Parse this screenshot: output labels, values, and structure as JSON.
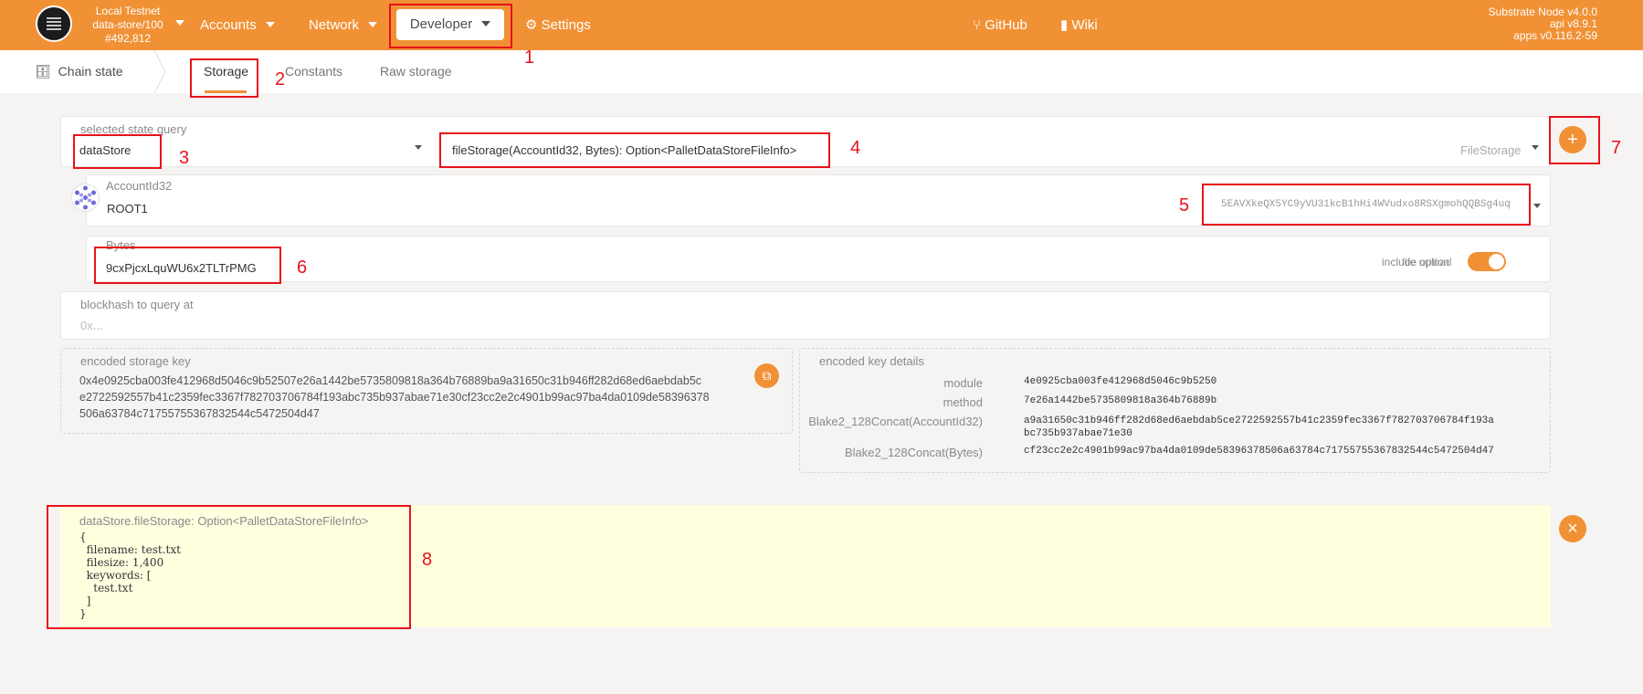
{
  "topbar": {
    "chain_name": "Local Testnet",
    "chain_runtime": "data-store/100",
    "block": "#492,812",
    "nav": {
      "accounts": "Accounts",
      "network": "Network",
      "developer": "Developer",
      "settings": "Settings",
      "github": "GitHub",
      "wiki": "Wiki"
    },
    "version": {
      "node": "Substrate Node v4.0.0",
      "api": "api v8.9.1",
      "apps": "apps v0.116.2-59"
    }
  },
  "subnav": {
    "section": "Chain state",
    "tabs": [
      "Storage",
      "Constants",
      "Raw storage"
    ]
  },
  "query": {
    "label": "selected state query",
    "module": "dataStore",
    "method": "fileStorage(AccountId32, Bytes): Option<PalletDataStoreFileInfo>",
    "doc": "FileStorage"
  },
  "account": {
    "label": "AccountId32",
    "name": "ROOT1",
    "address": "5EAVXkeQX5YC9yVU31kcB1hHi4WVudxo8RSXgmohQQBSg4uq"
  },
  "bytes": {
    "label": "Bytes",
    "value": "9cxPjcxLquWU6x2TLTrPMG",
    "toggle_label_1": "include option",
    "toggle_label_2": "file upload"
  },
  "blockhash": {
    "label": "blockhash to query at",
    "placeholder": "0x..."
  },
  "encoded_key": {
    "label": "encoded storage key",
    "lines": [
      "0x4e0925cba003fe412968d5046c9b52507e26a1442be5735809818a364b76889ba9a31650c31b946ff282d68ed6aebdab5c",
      "e2722592557b41c2359fec3367f782703706784f193abc735b937abae71e30cf23cc2e2c4901b99ac97ba4da0109de58396378",
      "506a63784c71755755367832544c5472504d47"
    ]
  },
  "key_details": {
    "label": "encoded key details",
    "rows": [
      {
        "k": "module",
        "v": "4e0925cba003fe412968d5046c9b5250"
      },
      {
        "k": "method",
        "v": "7e26a1442be5735809818a364b76889b"
      },
      {
        "k": "Blake2_128Concat(AccountId32)",
        "v": "a9a31650c31b946ff282d68ed6aebdab5ce2722592557b41c2359fec3367f782703706784f193a",
        "v2": "bc735b937abae71e30"
      },
      {
        "k": "Blake2_128Concat(Bytes)",
        "v": "cf23cc2e2c4901b99ac97ba4da0109de58396378506a63784c71755755367832544c5472504d47"
      }
    ]
  },
  "result": {
    "title": "dataStore.fileStorage: Option<PalletDataStoreFileInfo>",
    "body": "{\n  filename: test.txt\n  filesize: 1,400\n  keywords: [\n    test.txt\n  ]\n}"
  },
  "annotations": [
    "1",
    "2",
    "3",
    "4",
    "5",
    "6",
    "7",
    "8"
  ],
  "colors": {
    "accent": "#f19135",
    "annotation": "#e8121a",
    "result_bg": "#ffffe0"
  }
}
